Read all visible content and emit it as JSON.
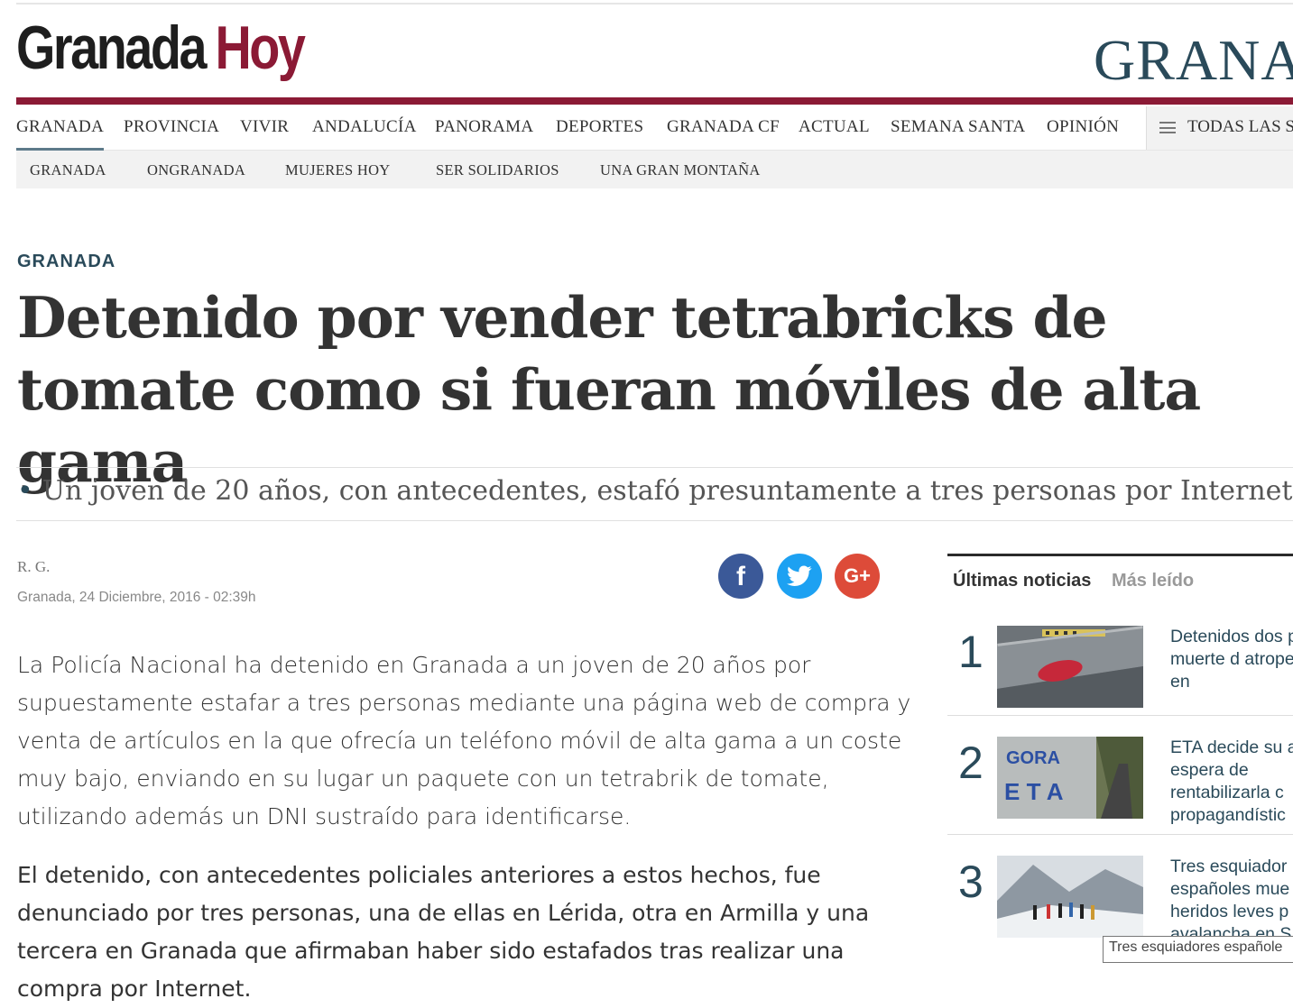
{
  "logo": {
    "word1": "Granada",
    "word2": "Hoy"
  },
  "edition_label": "GRANA",
  "nav_primary": [
    {
      "label": "GRANADA"
    },
    {
      "label": "PROVINCIA"
    },
    {
      "label": "VIVIR"
    },
    {
      "label": "ANDALUCÍA"
    },
    {
      "label": "PANORAMA"
    },
    {
      "label": "DEPORTES"
    },
    {
      "label": "GRANADA CF"
    },
    {
      "label": "ACTUAL"
    },
    {
      "label": "SEMANA SANTA"
    },
    {
      "label": "OPINIÓN"
    }
  ],
  "all_sections_label": "TODAS LAS SE",
  "nav_secondary": [
    {
      "label": "GRANADA"
    },
    {
      "label": "ONGRANADA"
    },
    {
      "label": "MUJERES HOY"
    },
    {
      "label": "SER SOLIDARIOS"
    },
    {
      "label": "UNA GRAN MONTAÑA"
    }
  ],
  "article": {
    "section": "GRANADA",
    "headline": "Detenido por vender tetrabricks de tomate como si fueran móviles de alta gama",
    "subtitle": "Un joven de 20 años, con antecedentes, estafó presuntamente a tres personas por Internet",
    "author": "R. G.",
    "date": "Granada, 24 Diciembre, 2016 - 02:39h",
    "paragraphs": [
      "La Policía Nacional ha detenido en Granada a un joven de 20 años por supuestamente estafar a tres personas mediante una página web de compra y venta de artículos en la que ofrecía un teléfono móvil de alta gama a un coste muy bajo, enviando en su lugar un paquete con un tetrabrik de tomate, utilizando además un DNI sustraído para identificarse.",
      "El detenido, con antecedentes policiales anteriores a estos hechos, fue denunciado por tres personas, una de ellas en Lérida, otra en Armilla y una tercera en Granada que afirmaban haber sido estafados tras realizar una compra por Internet."
    ]
  },
  "social": {
    "facebook": "f",
    "google": "G+"
  },
  "sidebar": {
    "tabs": [
      {
        "label": "Últimas noticias"
      },
      {
        "label": "Más leído"
      }
    ],
    "items": [
      {
        "rank": "1",
        "title": "Detenidos dos por la muerte d atropellado en"
      },
      {
        "rank": "2",
        "title": "ETA decide su a la espera de rentabilizarla c propagandístic"
      },
      {
        "rank": "3",
        "title": "Tres esquiador españoles mue heridos leves p avalancha en S"
      }
    ]
  },
  "tooltip": "Tres esquiadores españole"
}
